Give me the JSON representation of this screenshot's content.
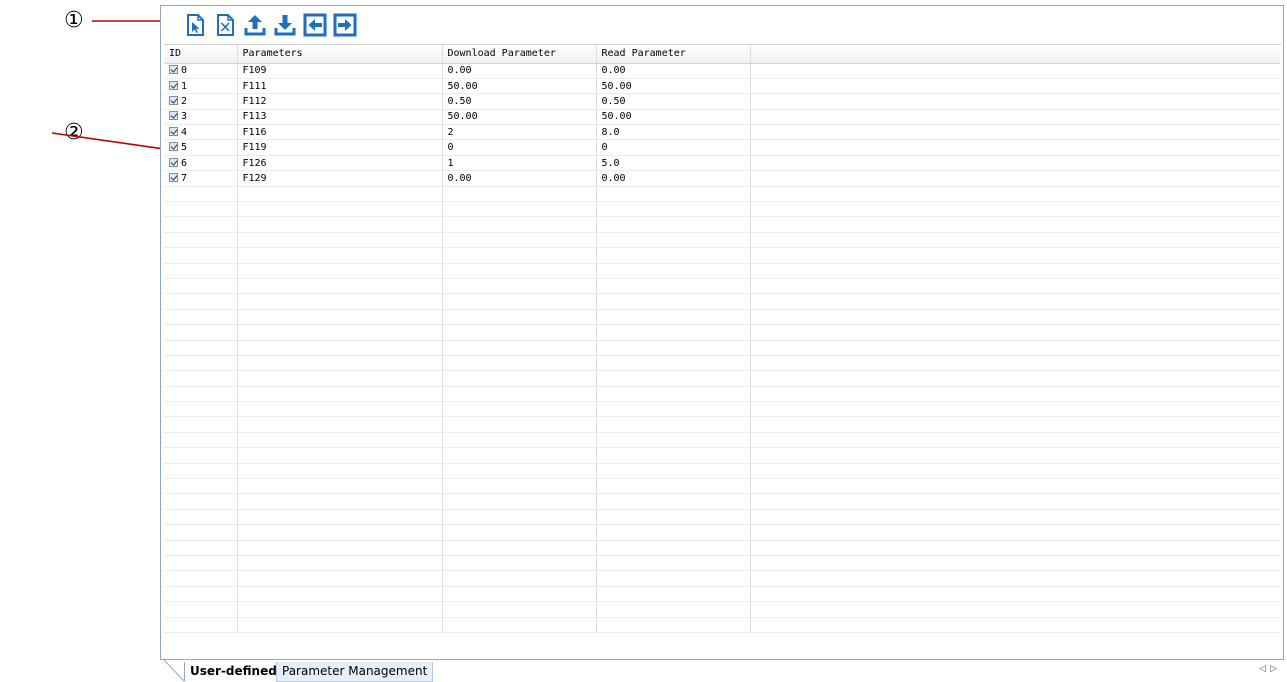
{
  "callouts": {
    "one": "①",
    "two": "②"
  },
  "toolbar": {
    "buttons": [
      {
        "icon": "select-file-icon"
      },
      {
        "icon": "clear-file-icon"
      },
      {
        "icon": "upload-icon"
      },
      {
        "icon": "download-icon"
      },
      {
        "icon": "import-left-icon"
      },
      {
        "icon": "export-right-icon"
      }
    ],
    "accent": "#1e6fc2"
  },
  "table": {
    "headers": {
      "id": "ID",
      "param": "Parameters",
      "download": "Download Parameter",
      "read": "Read Parameter"
    },
    "rows": [
      {
        "id": "0",
        "param": "F109",
        "download": "0.00",
        "read": "0.00",
        "checked": true
      },
      {
        "id": "1",
        "param": "F111",
        "download": "50.00",
        "read": "50.00",
        "checked": true
      },
      {
        "id": "2",
        "param": "F112",
        "download": "0.50",
        "read": "0.50",
        "checked": true
      },
      {
        "id": "3",
        "param": "F113",
        "download": "50.00",
        "read": "50.00",
        "checked": true
      },
      {
        "id": "4",
        "param": "F116",
        "download": "2",
        "read": "8.0",
        "checked": true
      },
      {
        "id": "5",
        "param": "F119",
        "download": "0",
        "read": "0",
        "checked": true
      },
      {
        "id": "6",
        "param": "F126",
        "download": "1",
        "read": "5.0",
        "checked": true
      },
      {
        "id": "7",
        "param": "F129",
        "download": "0.00",
        "read": "0.00",
        "checked": true
      }
    ]
  },
  "tabs": {
    "active": "User-defined",
    "inactive": "Parameter Management"
  },
  "colors": {
    "arrow": "#c00000",
    "border": "#8fa8c8"
  }
}
